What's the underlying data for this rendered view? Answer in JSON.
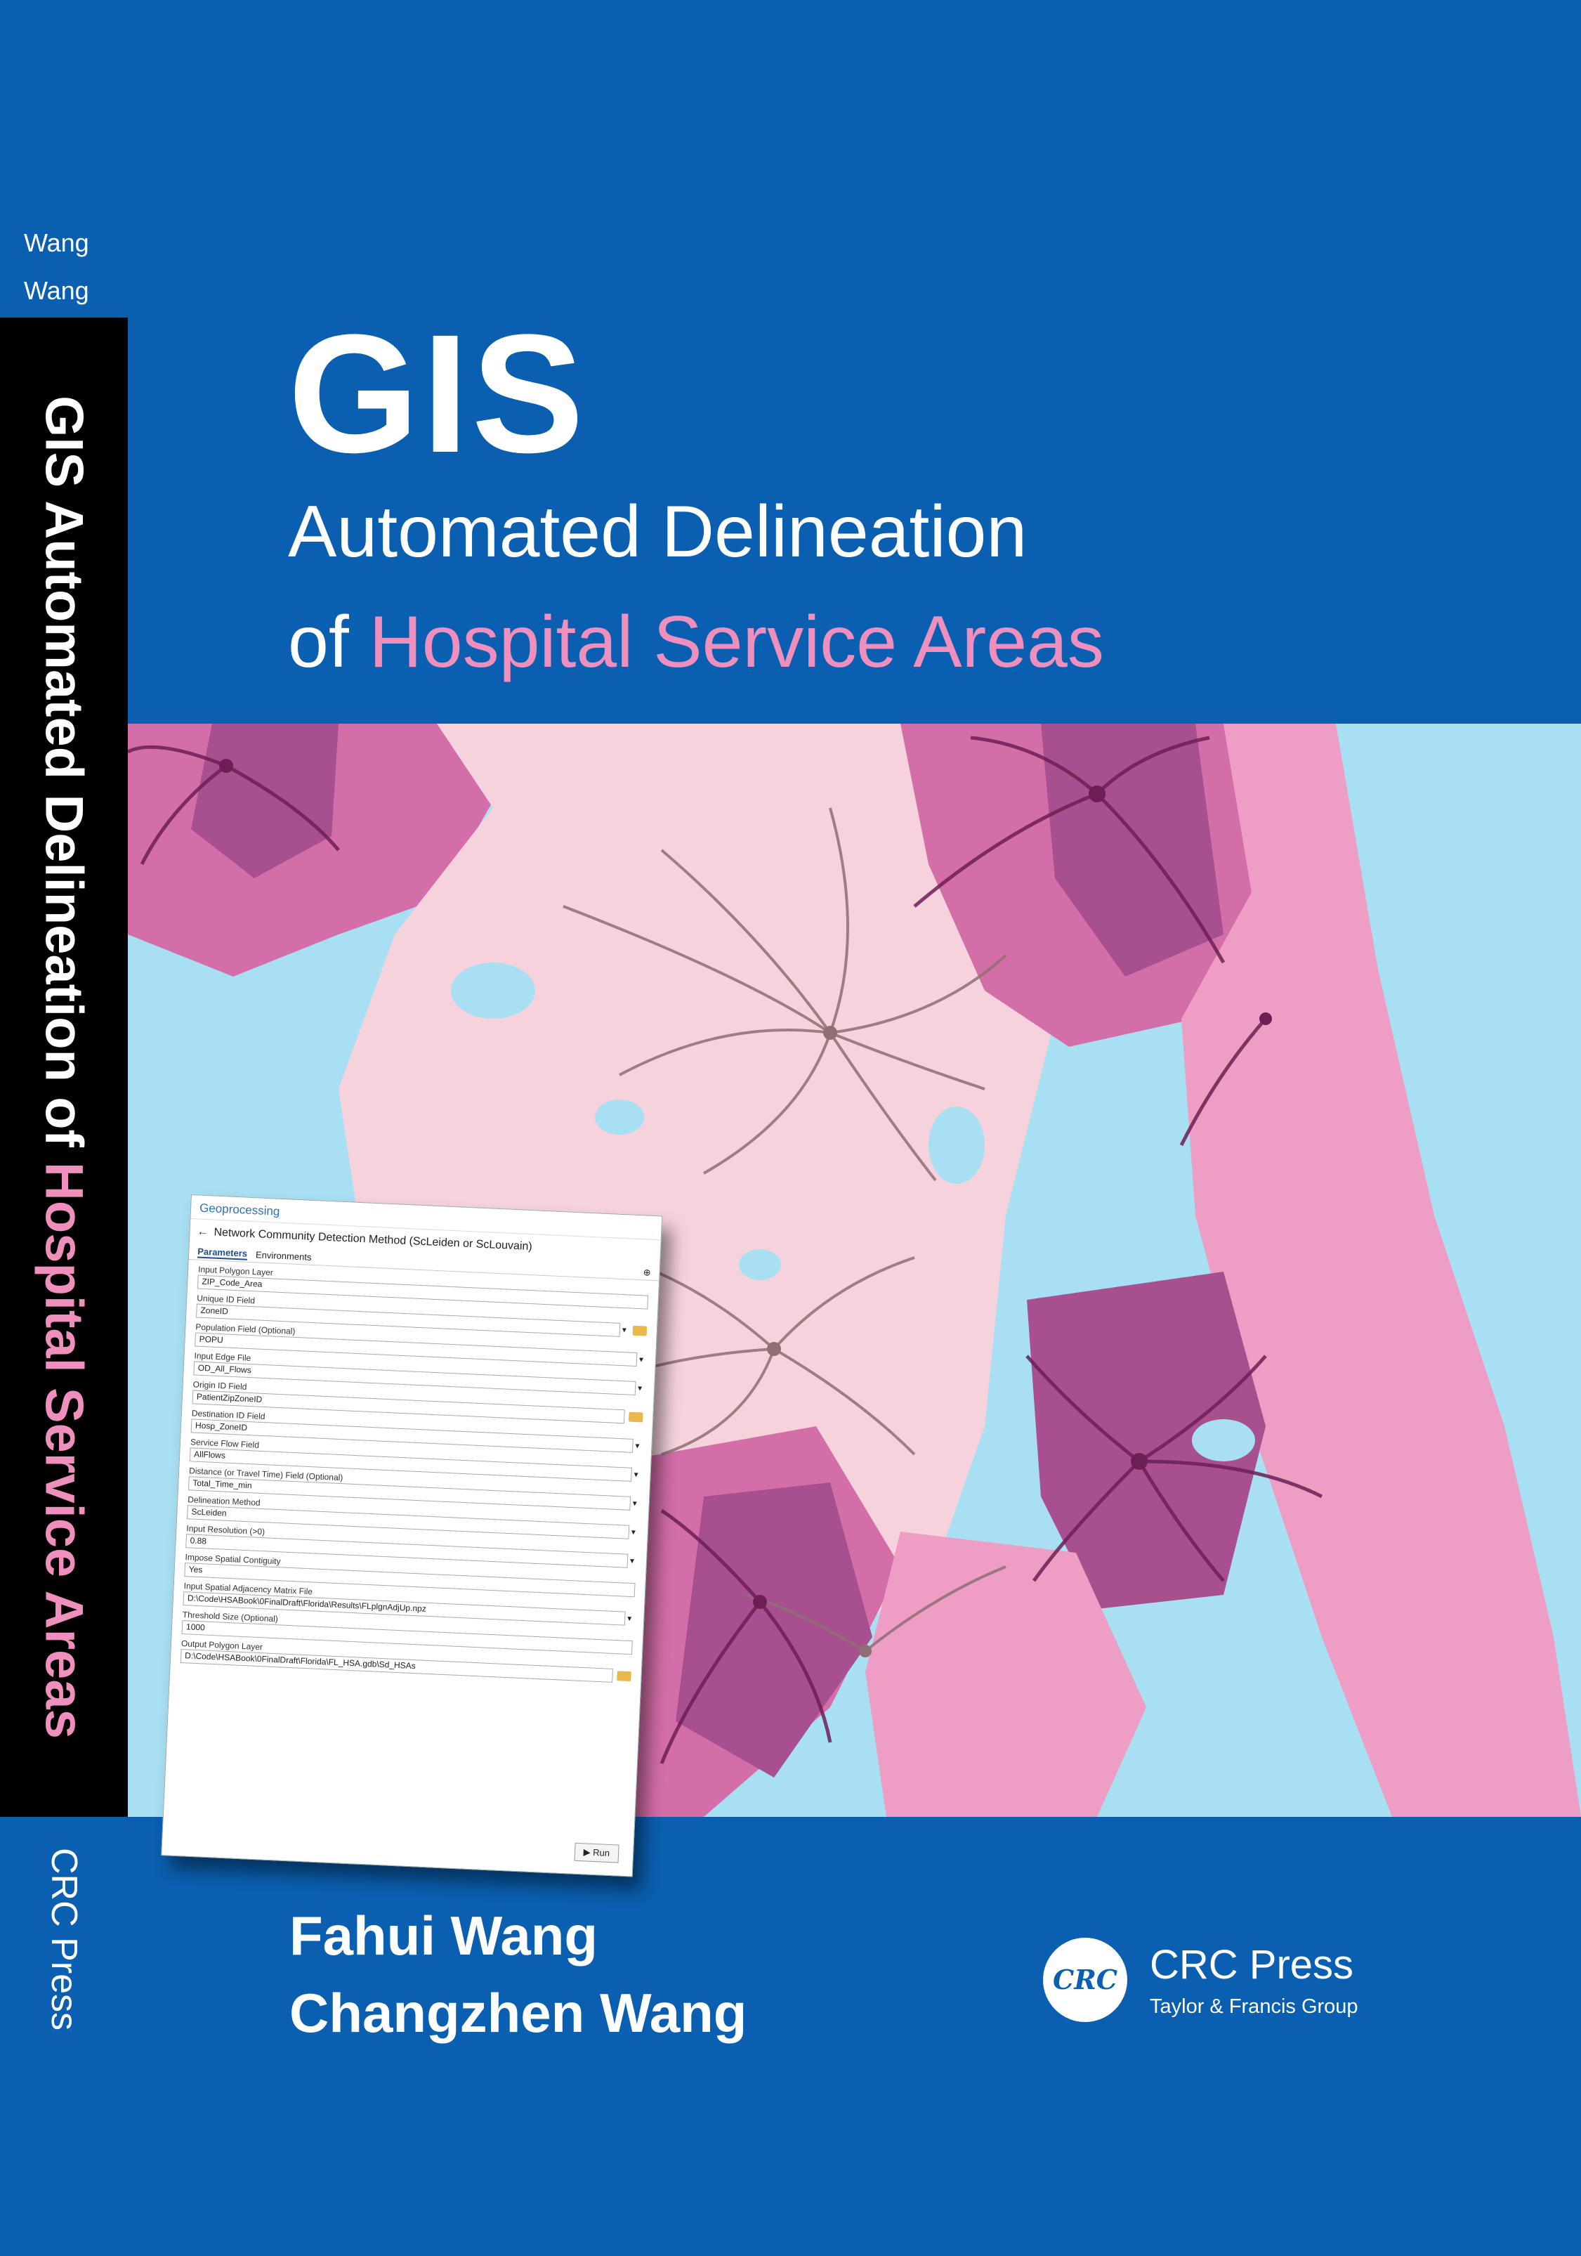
{
  "spine": {
    "author1": "Wang",
    "author2": "Wang",
    "title_main": "GIS Automated Delineation of ",
    "title_pink": "Hospital Service Areas",
    "publisher": "CRC Press"
  },
  "title": {
    "line1": "GIS",
    "line2": "Automated Delineation",
    "line3_prefix": "of ",
    "line3_highlight": "Hospital Service Areas"
  },
  "colors": {
    "background": "#0a5fb0",
    "highlight_pink": "#ef8fbd",
    "water": "#a9dff3",
    "region_light": "#f6d3dc",
    "region_pink": "#ee9ec4",
    "region_medium": "#d36ea8",
    "region_dark": "#a84f90",
    "flow_brown": "#8f6f73",
    "flow_purple": "#6d1f55"
  },
  "dialog": {
    "header": "Geoprocessing",
    "tool_title": "Network Community Detection Method (ScLeiden or ScLouvain)",
    "tabs": [
      "Parameters",
      "Environments"
    ],
    "params": [
      {
        "label": "Input Polygon Layer",
        "value": "ZIP_Code_Area",
        "control": "none"
      },
      {
        "label": "Unique ID Field",
        "value": "ZoneID",
        "control": "dropdown-folder"
      },
      {
        "label": "Population Field (Optional)",
        "value": "POPU",
        "control": "dropdown"
      },
      {
        "label": "Input Edge File",
        "value": "OD_All_Flows",
        "control": "dropdown"
      },
      {
        "label": "Origin ID Field",
        "value": "PatientZipZoneID",
        "control": "folder"
      },
      {
        "label": "Destination ID Field",
        "value": "Hosp_ZoneID",
        "control": "dropdown"
      },
      {
        "label": "Service Flow Field",
        "value": "AllFlows",
        "control": "dropdown"
      },
      {
        "label": "Distance (or Travel Time) Field (Optional)",
        "value": "Total_Time_min",
        "control": "dropdown"
      },
      {
        "label": "Delineation Method",
        "value": "ScLeiden",
        "control": "dropdown"
      },
      {
        "label": "Input Resolution (>0)",
        "value": "0.88",
        "control": "dropdown"
      },
      {
        "label": "Impose Spatial Contiguity",
        "value": "Yes",
        "control": "none"
      },
      {
        "label": "Input Spatial Adjacency Matrix File",
        "value": "D:\\Code\\HSABook\\0FinalDraft\\Florida\\Results\\FLplgnAdjUp.npz",
        "control": "dropdown"
      },
      {
        "label": "Threshold Size (Optional)",
        "value": "1000",
        "control": "none"
      },
      {
        "label": "Output Polygon Layer",
        "value": "D:\\Code\\HSABook\\0FinalDraft\\Florida\\FL_HSA.gdb\\Sd_HSAs",
        "control": "folder"
      }
    ],
    "run_label": "Run"
  },
  "authors": [
    "Fahui Wang",
    "Changzhen Wang"
  ],
  "publisher": {
    "logo_text": "CRC",
    "name": "CRC Press",
    "tagline": "Taylor & Francis Group"
  }
}
